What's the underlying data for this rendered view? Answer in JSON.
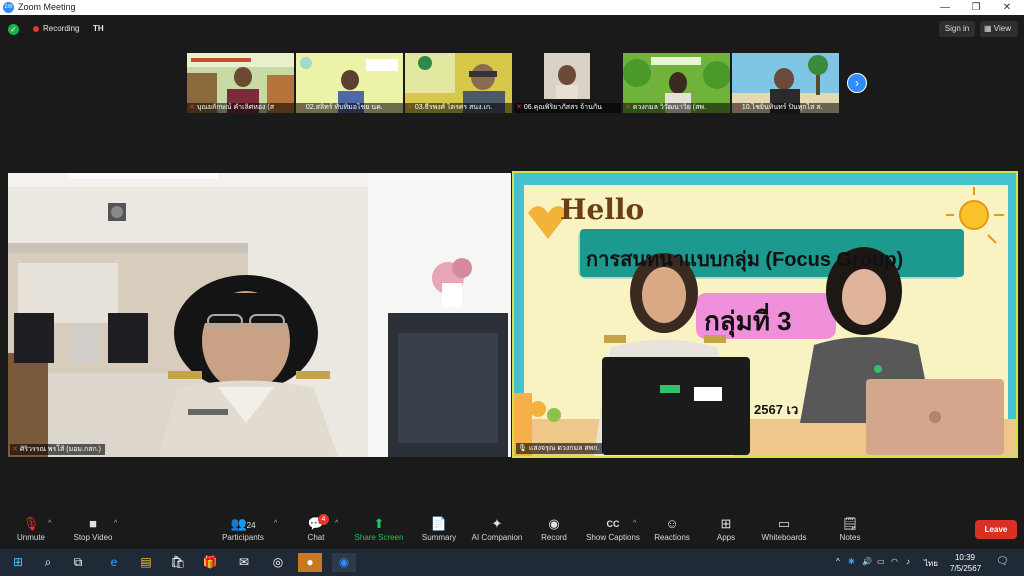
{
  "window": {
    "title": "Zoom Meeting",
    "logo": "zm"
  },
  "topbar": {
    "recording_label": "Recording",
    "language": "TH",
    "sign_in": "Sign in",
    "view": "View"
  },
  "thumbnails": [
    {
      "name": "บุณยลักษณ์ คำเลิศหอง (ส"
    },
    {
      "name": "02.สลิทร์ ทับทิมอไชย นค."
    },
    {
      "name": "03.ธีรพงศ์ ไตรศร สนง.เก."
    },
    {
      "name": "06.คุณพิริยาภัสสร จ้านกัน"
    },
    {
      "name": "ดวงกมล วิวัฒนาวิย (สพ."
    },
    {
      "name": "10.ไชยินทินทร์ ปิ่นทุกไส ส."
    }
  ],
  "main_tiles": {
    "left_name": "ศิริวรรณ พรโส้ (มอม.กสก.)",
    "right_name": "แสงจรุณ ดวงกมล สพก.",
    "slide": {
      "hello": "Hello",
      "title": "การสนทนาแบบกลุ่ม (Focus Group)",
      "group": "กลุ่มที่ 3",
      "date_fragment": "2567 เว"
    }
  },
  "toolbar": {
    "unmute": "Unmute",
    "stop_video": "Stop Video",
    "participants": "Participants",
    "participants_count": "24",
    "chat": "Chat",
    "chat_badge": "4",
    "share_screen": "Share Screen",
    "summary": "Summary",
    "ai_companion": "AI Companion",
    "record": "Record",
    "show_captions": "Show Captions",
    "reactions": "Reactions",
    "apps": "Apps",
    "whiteboards": "Whiteboards",
    "notes": "Notes",
    "leave": "Leave"
  },
  "taskbar": {
    "lang": "ไทย",
    "time": "10:39",
    "date": "7/5/2567"
  },
  "colors": {
    "zoom_blue": "#2d8cff",
    "leave_red": "#d93025",
    "share_green": "#22c55e",
    "active_speaker": "#d6e04a"
  }
}
